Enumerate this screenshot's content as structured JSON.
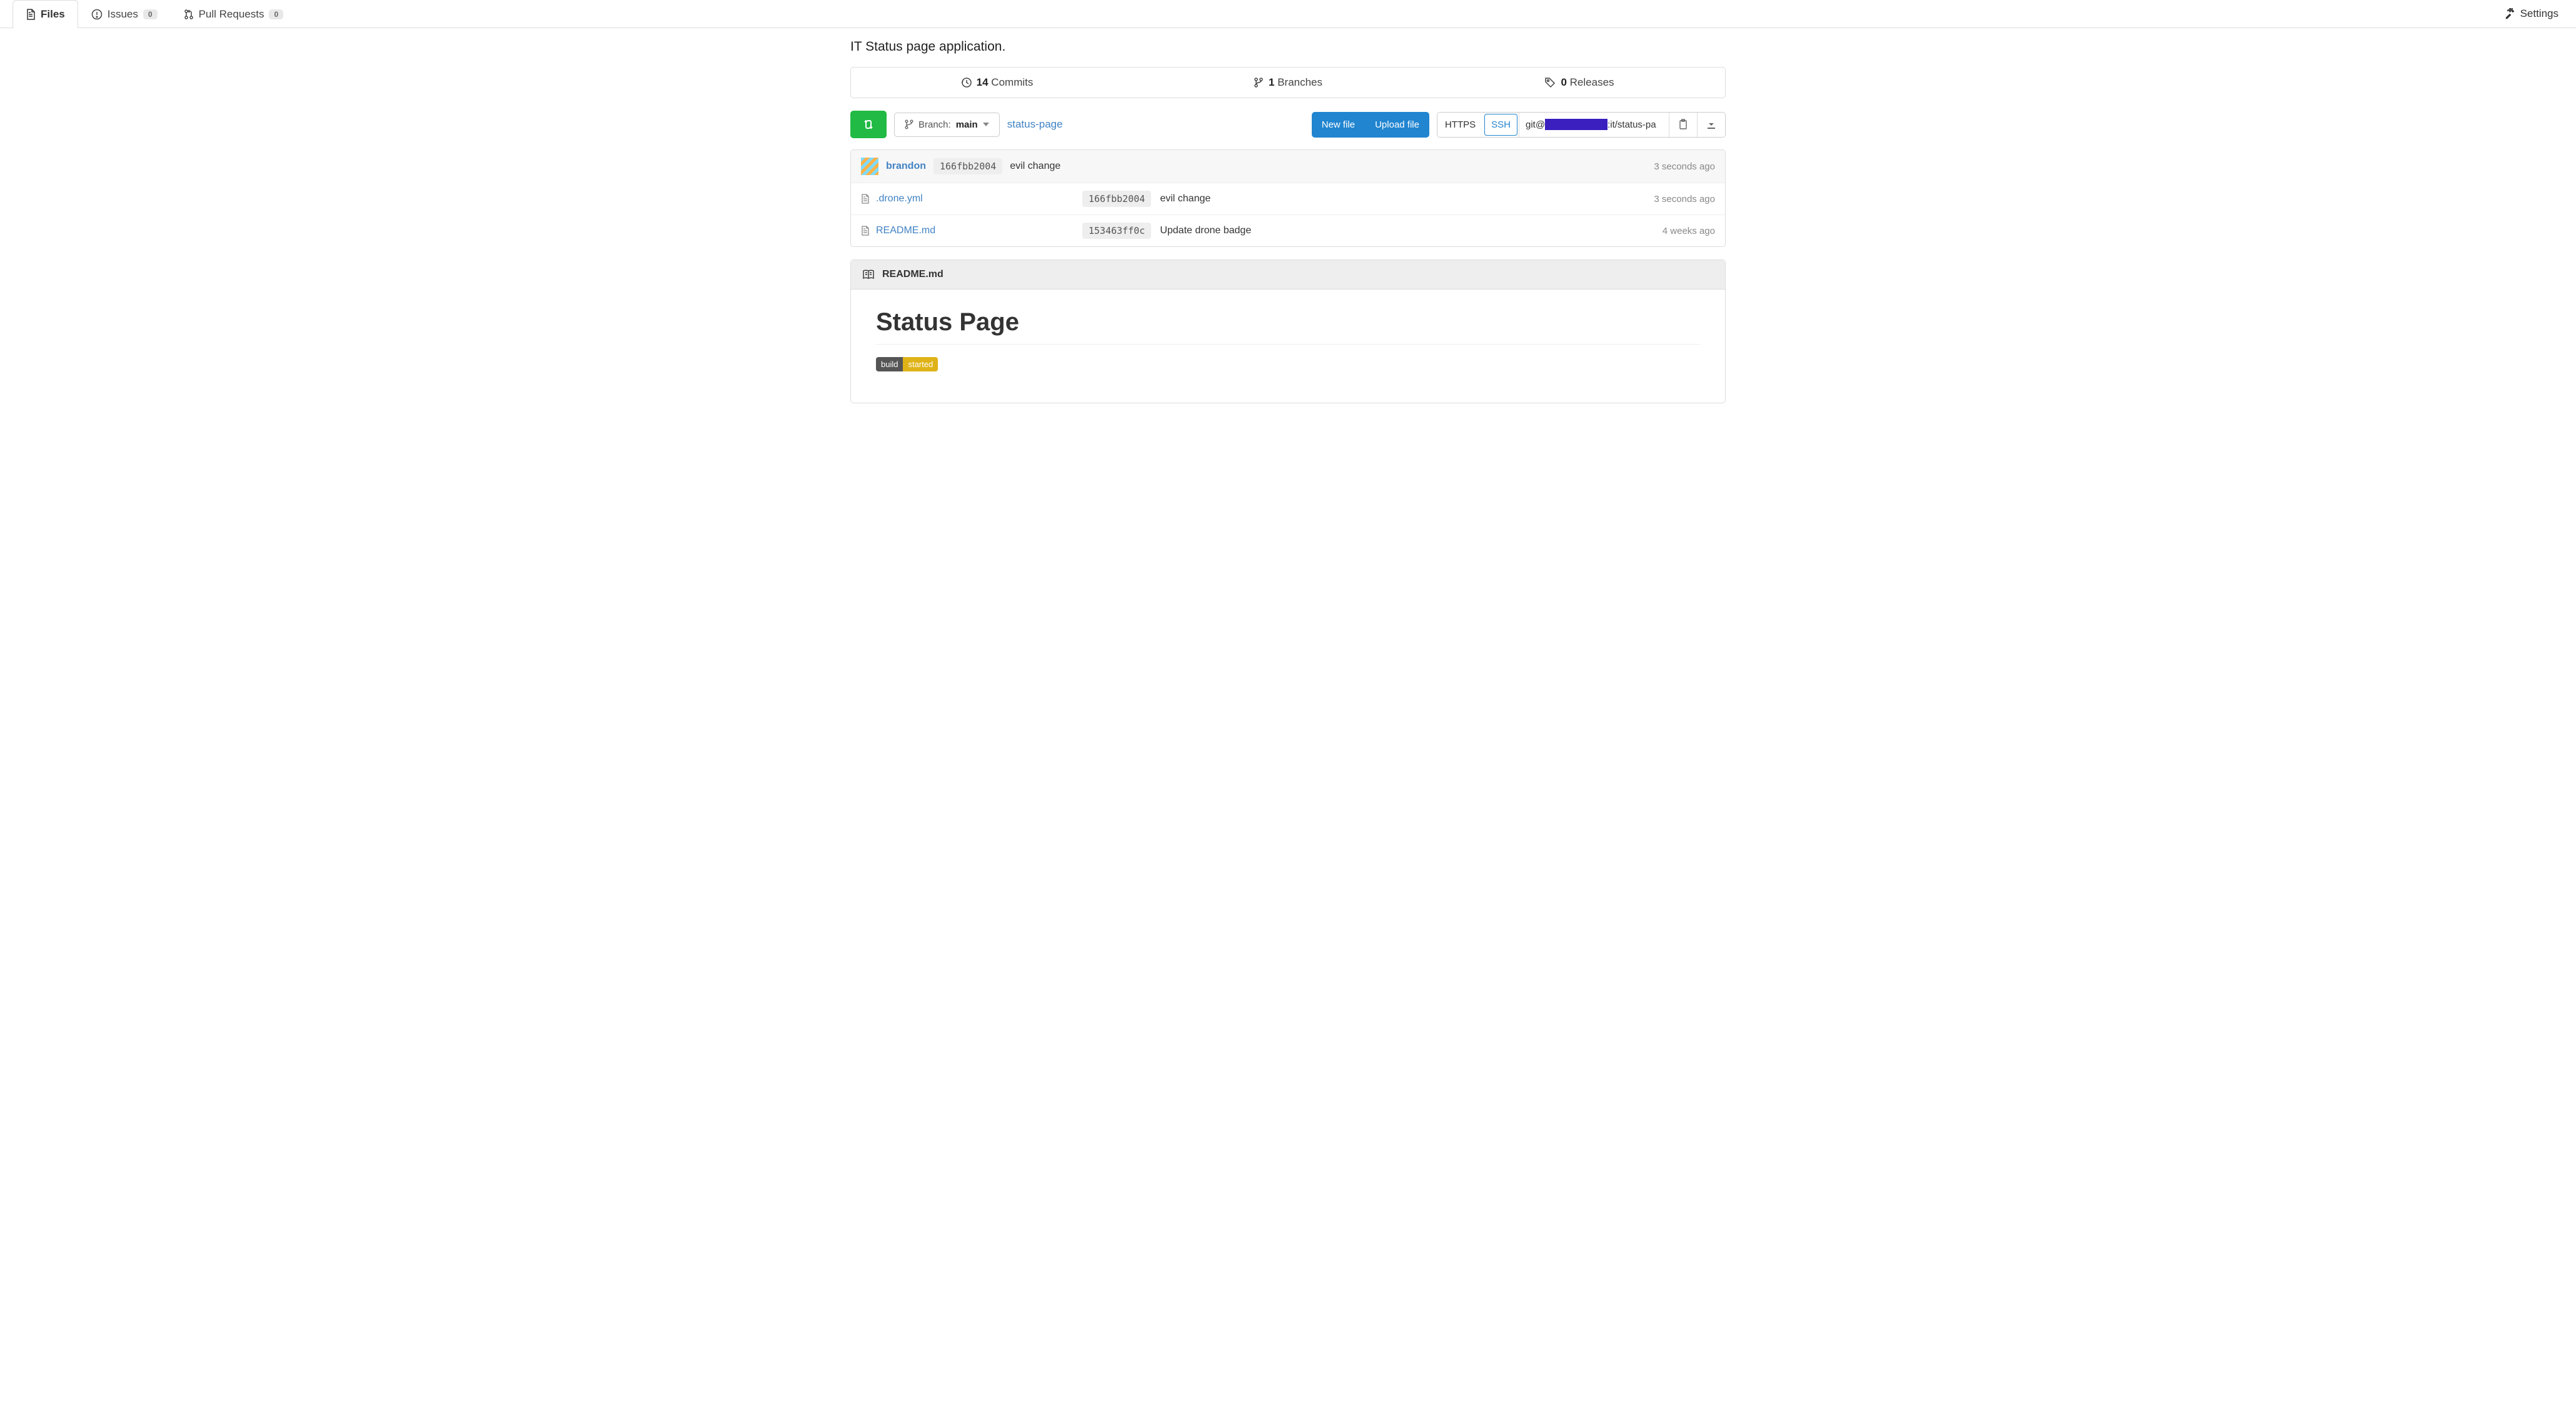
{
  "tabs": {
    "files": "Files",
    "issues": "Issues",
    "issues_count": "0",
    "pulls": "Pull Requests",
    "pulls_count": "0",
    "settings": "Settings"
  },
  "description": "IT Status page application.",
  "stats": {
    "commits_count": "14",
    "commits_label": "Commits",
    "branches_count": "1",
    "branches_label": "Branches",
    "releases_count": "0",
    "releases_label": "Releases"
  },
  "toolbar": {
    "branch_prefix": "Branch:",
    "branch_name": "main",
    "breadcrumb": "status-page",
    "new_file": "New file",
    "upload_file": "Upload file",
    "proto_https": "HTTPS",
    "proto_ssh": "SSH",
    "clone_url_prefix": "git@",
    "clone_url_suffix": ":it/status-pa"
  },
  "latest_commit": {
    "author": "brandon",
    "sha": "166fbb2004",
    "message": "evil change",
    "time": "3 seconds ago"
  },
  "files": [
    {
      "name": ".drone.yml",
      "sha": "166fbb2004",
      "message": "evil change",
      "time": "3 seconds ago"
    },
    {
      "name": "README.md",
      "sha": "153463ff0c",
      "message": "Update drone badge",
      "time": "4 weeks ago"
    }
  ],
  "readme": {
    "filename": "README.md",
    "title": "Status Page",
    "badge_label": "build",
    "badge_value": "started"
  }
}
